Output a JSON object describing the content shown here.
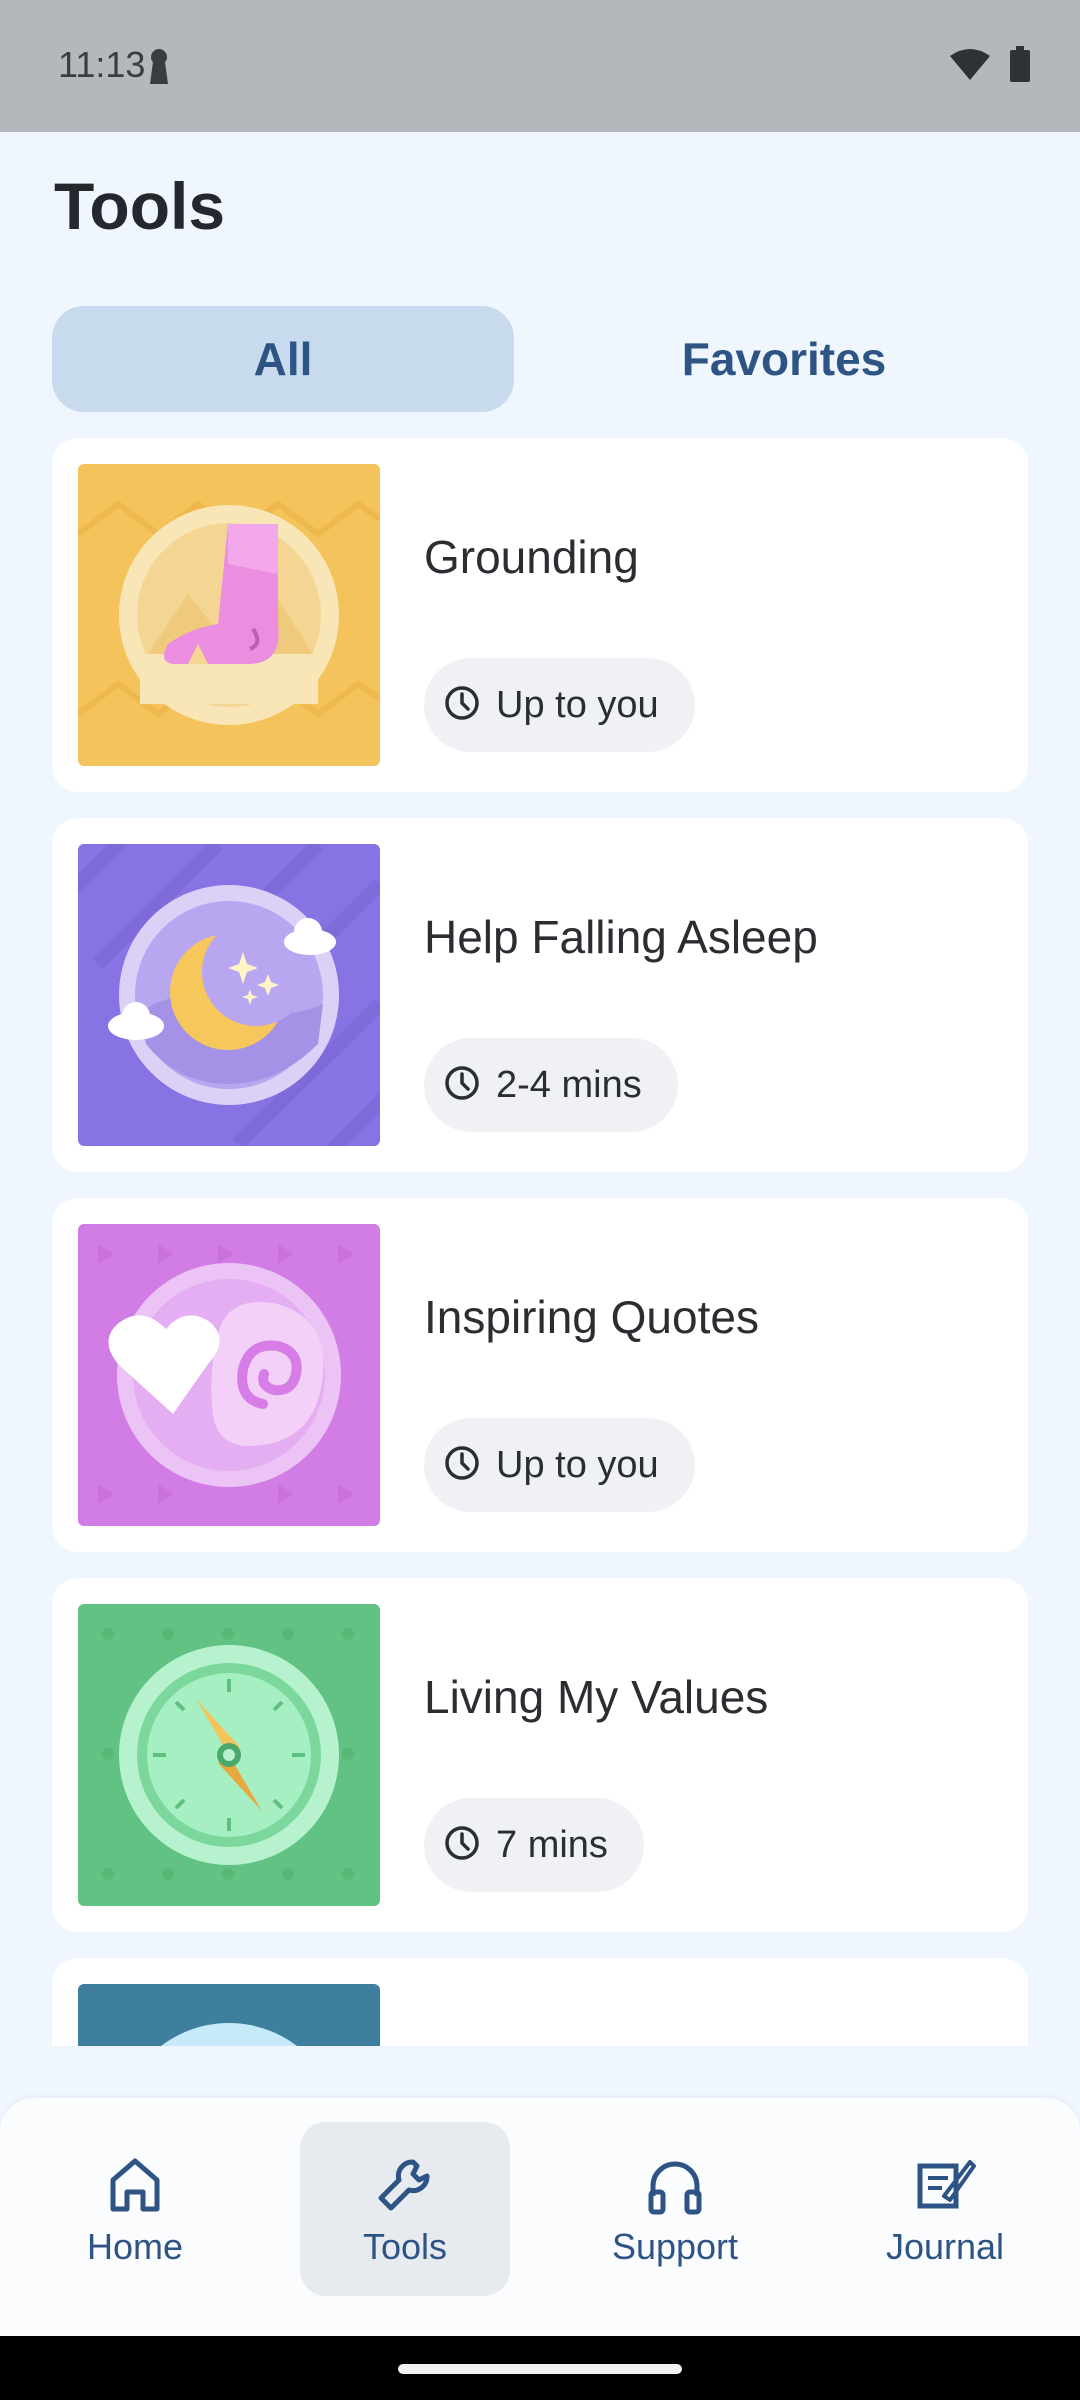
{
  "status_bar": {
    "time": "11:13"
  },
  "page": {
    "title": "Tools"
  },
  "tabs": {
    "all": "All",
    "favorites": "Favorites"
  },
  "tools": [
    {
      "title": "Grounding",
      "duration": "Up to you",
      "icon": "foot-grounding-icon",
      "color": "#f5c35b"
    },
    {
      "title": "Help Falling Asleep",
      "duration": "2-4 mins",
      "icon": "moon-stars-icon",
      "color": "#8773e4"
    },
    {
      "title": "Inspiring Quotes",
      "duration": "Up to you",
      "icon": "heart-swirl-icon",
      "color": "#d27ce6"
    },
    {
      "title": "Living My Values",
      "duration": "7 mins",
      "icon": "compass-icon",
      "color": "#62c283"
    },
    {
      "title": "",
      "duration": "",
      "icon": "partial-card-icon",
      "color": "#3f7f9e"
    }
  ],
  "bottom_nav": [
    {
      "label": "Home",
      "icon": "home-icon"
    },
    {
      "label": "Tools",
      "icon": "wrench-icon",
      "active": true
    },
    {
      "label": "Support",
      "icon": "headphones-icon"
    },
    {
      "label": "Journal",
      "icon": "journal-icon"
    }
  ],
  "colors": {
    "accent": "#2e5485",
    "background": "#f0f6fe",
    "tab_active": "#c8daee"
  }
}
